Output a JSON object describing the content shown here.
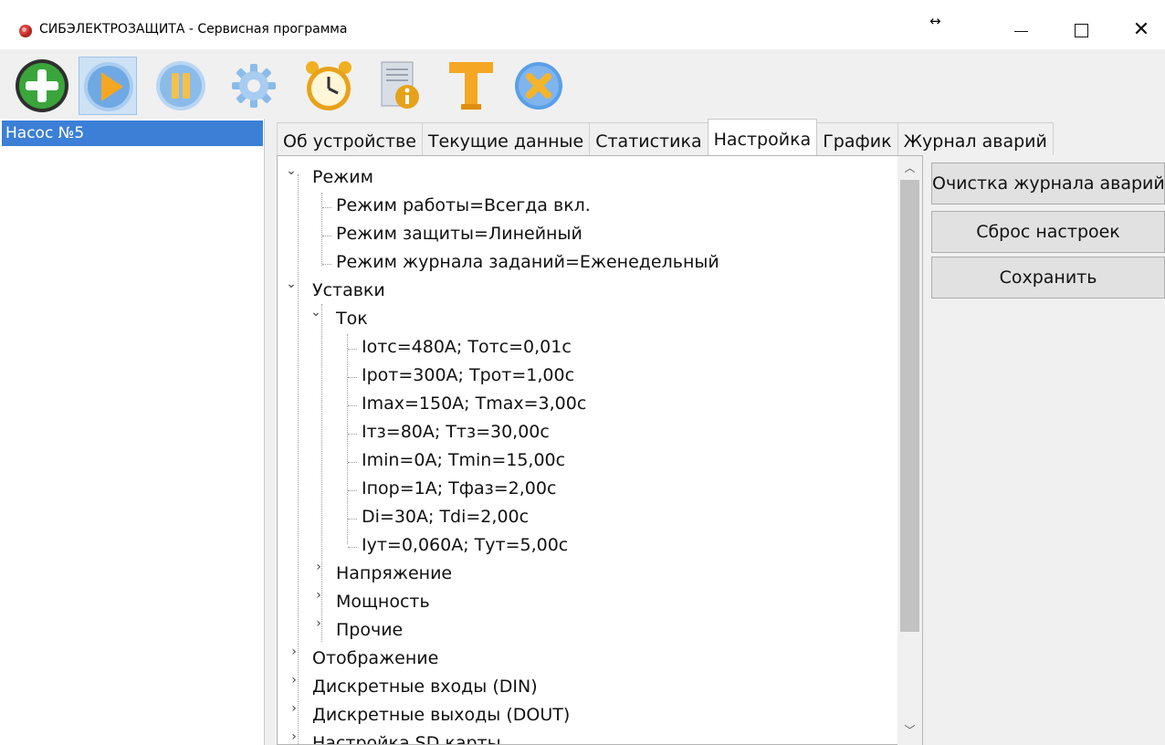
{
  "window": {
    "title": "СИБЭЛЕКТРОЗАЩИТА - Сервисная программа",
    "resize_glyph": "↔",
    "close_glyph": "✕"
  },
  "toolbar": {
    "buttons": [
      {
        "icon": "add-icon",
        "color": "#3aa53a"
      },
      {
        "icon": "play-icon",
        "color": "#f5a623",
        "active": true
      },
      {
        "icon": "pause-icon",
        "color": "#f5c04a"
      },
      {
        "icon": "gear-icon",
        "color": "#7fb0e0"
      },
      {
        "icon": "alarm-clock-icon",
        "color": "#f0b020"
      },
      {
        "icon": "info-document-icon",
        "color": "#4a8fd8"
      },
      {
        "icon": "text-tool-icon",
        "color": "#f5a623"
      },
      {
        "icon": "cancel-icon",
        "color": "#5aa0e8"
      }
    ]
  },
  "devices": [
    {
      "label": "Насос №5",
      "selected": true
    }
  ],
  "tabs": [
    {
      "label": "Об устройстве"
    },
    {
      "label": "Текущие данные"
    },
    {
      "label": "Статистика"
    },
    {
      "label": "Настройка",
      "active": true
    },
    {
      "label": "График"
    },
    {
      "label": "Журнал аварий"
    }
  ],
  "tree": {
    "mode": {
      "label": "Режим",
      "items": [
        "Режим работы=Всегда вкл.",
        "Режим защиты=Линейный",
        "Режим журнала заданий=Еженедельный"
      ]
    },
    "setpoints": {
      "label": "Уставки",
      "current": {
        "label": "Ток",
        "items": [
          "Iотс=480А;  Tотс=0,01с",
          "Iрот=300А;  Tрот=1,00с",
          "Imax=150А;  Tmax=3,00с",
          "Iтз=80А;  Tтз=30,00с",
          "Imin=0А;  Tmin=15,00с",
          "Iпор=1А;  Tфаз=2,00с",
          "Di=30А;  Tdi=2,00с",
          "Iут=0,060А;  Tут=5,00с"
        ]
      },
      "voltage": "Напряжение",
      "power": "Мощность",
      "other": "Прочие"
    },
    "display": "Отображение",
    "din": "Дискретные входы (DIN)",
    "dout": "Дискретные выходы (DOUT)",
    "sd": "Настройка SD карты"
  },
  "actions": {
    "clear_log": "Очистка журнала аварий",
    "reset": "Сброс настроек",
    "save": "Сохранить"
  }
}
